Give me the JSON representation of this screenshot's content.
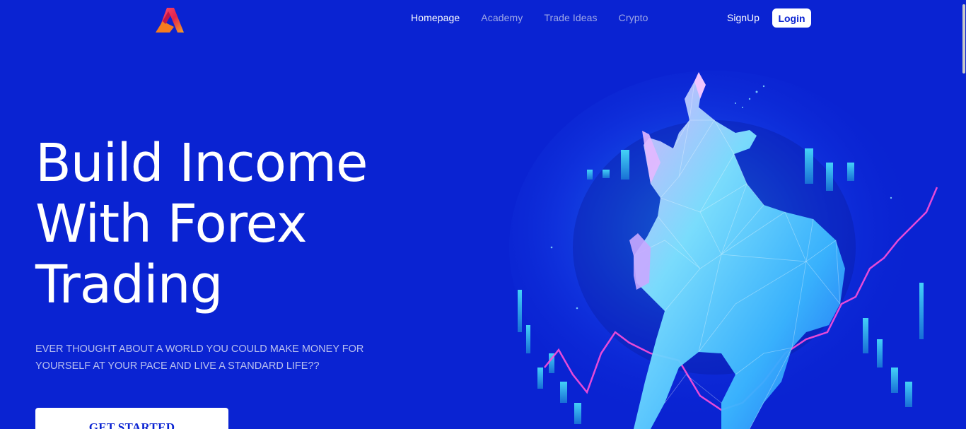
{
  "nav": {
    "items": [
      {
        "label": "Homepage",
        "active": true
      },
      {
        "label": "Academy",
        "active": false
      },
      {
        "label": "Trade Ideas",
        "active": false
      },
      {
        "label": "Crypto",
        "active": false
      }
    ],
    "signup_label": "SignUp",
    "login_label": "Login"
  },
  "hero": {
    "title_line1": "Build Income",
    "title_line2": "With Forex",
    "title_line3": "Trading",
    "subtitle": "EVER THOUGHT ABOUT A WORLD YOU COULD MAKE MONEY FOR YOURSELF AT YOUR PACE AND LIVE A STANDARD LIFE??",
    "cta_label": "GET STARTED"
  },
  "colors": {
    "background": "#0a23d2",
    "accent": "#ffffff",
    "muted_nav": "#9fa8e6"
  },
  "icons": {
    "logo": "brand-a-logo",
    "hero_image": "polygonal-bull-illustration"
  }
}
